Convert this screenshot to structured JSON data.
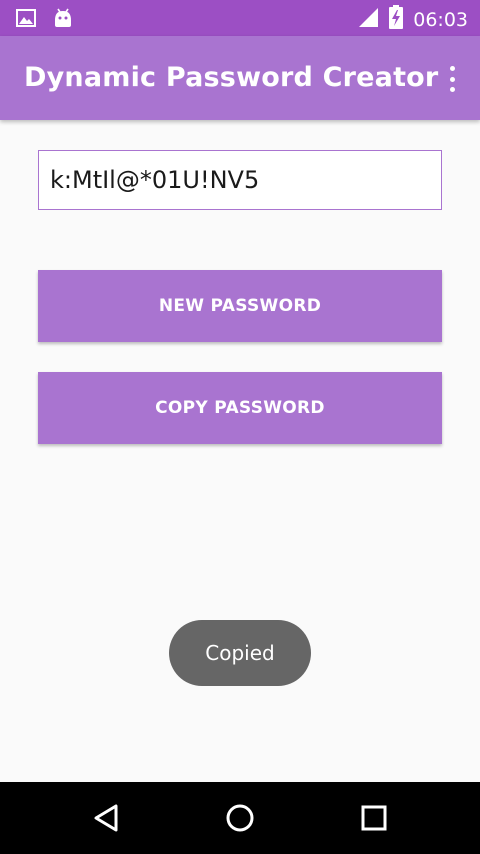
{
  "status_bar": {
    "time": "06:03",
    "icons": [
      "image-notification-icon",
      "android-notification-icon",
      "signal-icon",
      "battery-charging-icon"
    ]
  },
  "app_bar": {
    "title": "Dynamic Password Creator",
    "menu_icon": "overflow-menu-icon"
  },
  "password": {
    "value": "k:MtIl@*01U!NV5"
  },
  "buttons": {
    "new_password": "NEW PASSWORD",
    "copy_password": "COPY PASSWORD"
  },
  "toast": {
    "message": "Copied"
  },
  "nav_bar": {
    "icons": [
      "back-icon",
      "home-icon",
      "recents-icon"
    ]
  },
  "colors": {
    "status_bar": "#9c4fc4",
    "primary": "#a974d0",
    "background": "#fafafa",
    "toast": "#666666"
  }
}
